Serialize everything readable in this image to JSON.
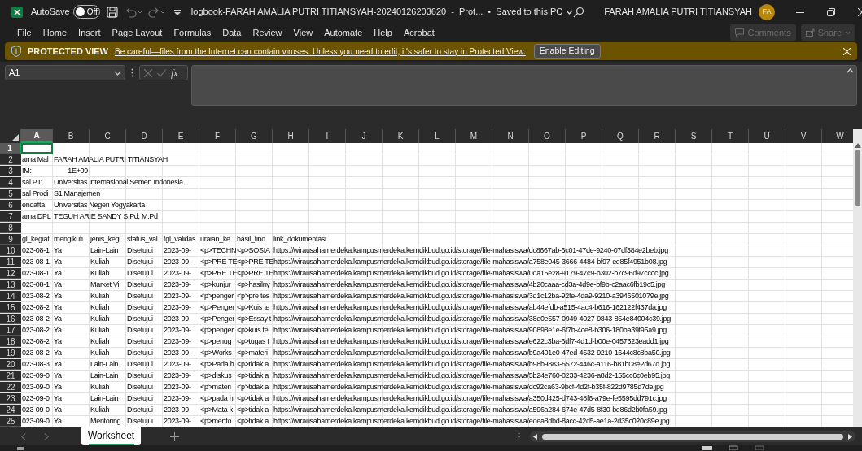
{
  "title_bar": {
    "autosave_label": "AutoSave",
    "autosave": {
      "label": "Off",
      "on": false
    },
    "document_title": "logbook-FARAH AMALIA PUTRI TITIANSYAH-20240126203620  -  Prot...",
    "save_status": "•  Saved to this PC",
    "user_name": "FARAH AMALIA PUTRI TITIANSYAH",
    "avatar_initials": "FA"
  },
  "menu": [
    {
      "label": "File"
    },
    {
      "label": "Home"
    },
    {
      "label": "Insert"
    },
    {
      "label": "Page Layout"
    },
    {
      "label": "Formulas"
    },
    {
      "label": "Data"
    },
    {
      "label": "Review"
    },
    {
      "label": "View"
    },
    {
      "label": "Automate"
    },
    {
      "label": "Help"
    },
    {
      "label": "Acrobat"
    }
  ],
  "ribbon_buttons": [
    {
      "label": "Comments",
      "disabled": true
    },
    {
      "label": "Share",
      "disabled": true
    }
  ],
  "protected_view": {
    "title": "PROTECTED VIEW",
    "message": "Be careful—files from the Internet can contain viruses. Unless you need to edit, it's safer to stay in Protected View.",
    "button": "Enable Editing"
  },
  "formula_bar": {
    "name_box": "A1",
    "function_label": "fx"
  },
  "columns": [
    {
      "label": "A",
      "selected": true
    },
    {
      "label": "B",
      "selected": false
    },
    {
      "label": "C",
      "selected": false
    },
    {
      "label": "D",
      "selected": false
    },
    {
      "label": "E",
      "selected": false
    },
    {
      "label": "F",
      "selected": false
    },
    {
      "label": "G",
      "selected": false
    },
    {
      "label": "H",
      "selected": false
    },
    {
      "label": "I",
      "selected": false
    },
    {
      "label": "J",
      "selected": false
    },
    {
      "label": "K",
      "selected": false
    },
    {
      "label": "L",
      "selected": false
    },
    {
      "label": "M",
      "selected": false
    },
    {
      "label": "N",
      "selected": false
    },
    {
      "label": "O",
      "selected": false
    },
    {
      "label": "P",
      "selected": false
    },
    {
      "label": "Q",
      "selected": false
    },
    {
      "label": "R",
      "selected": false
    },
    {
      "label": "S",
      "selected": false
    },
    {
      "label": "T",
      "selected": false
    },
    {
      "label": "U",
      "selected": false
    },
    {
      "label": "V",
      "selected": false
    },
    {
      "label": "W",
      "selected": false
    }
  ],
  "rows": [
    {
      "number": "1",
      "selected": true
    },
    {
      "number": "2",
      "selected": false,
      "cells": [
        "ama Mal",
        "FARAH AMALIA PUTRI TITIANSYAH"
      ]
    },
    {
      "number": "3",
      "selected": false,
      "cells": [
        "IM:",
        {
          "text": "1E+09",
          "kind": "number"
        }
      ]
    },
    {
      "number": "4",
      "selected": false,
      "cells": [
        "sal PT:",
        "Universitas Internasional Semen Indonesia"
      ]
    },
    {
      "number": "5",
      "selected": false,
      "cells": [
        "sal Prodi",
        "S1 Manajemen"
      ]
    },
    {
      "number": "6",
      "selected": false,
      "cells": [
        "endafta",
        "Universitas Negeri Yogyakarta"
      ]
    },
    {
      "number": "7",
      "selected": false,
      "cells": [
        "ama DPL",
        "TEGUH ARIE SANDY S.Pd, M.Pd"
      ]
    },
    {
      "number": "8",
      "selected": false
    },
    {
      "number": "9",
      "selected": false,
      "cells": [
        "gl_kegiat",
        "mengikuti",
        "jenis_kegi",
        "status_val",
        "tgl_validas",
        "uraian_ke",
        "hasil_tind",
        "link_dokumentasi"
      ]
    },
    {
      "number": "10",
      "selected": false,
      "cells": [
        "023-08-1",
        "Ya",
        "Lain-Lain",
        "Disetujui",
        "2023-09-",
        "<p>TECHN",
        "<p>SOSIA",
        "https://wirausahamerdeka.kampusmerdeka.kemdikbud.go.id/storage/file-mahasiswa/dc8667ab-6c01-47de-9240-07df384e2beb.jpg"
      ]
    },
    {
      "number": "11",
      "selected": false,
      "cells": [
        "023-08-1",
        "Ya",
        "Kuliah",
        "Disetujui",
        "2023-09-",
        "<p>PRE TE",
        "<p>PRE TE",
        "https://wirausahamerdeka.kampusmerdeka.kemdikbud.go.id/storage/file-mahasiswa/a758e045-3666-4484-bf97-ee85f4951b08.jpg"
      ]
    },
    {
      "number": "12",
      "selected": false,
      "cells": [
        "023-08-1",
        "Ya",
        "Kuliah",
        "Disetujui",
        "2023-09-",
        "<p>PRE TE",
        "<p>PRE TE",
        "https://wirausahamerdeka.kampusmerdeka.kemdikbud.go.id/storage/file-mahasiswa/0da15e28-9179-47c9-b302-b7c96d97cccc.jpg"
      ]
    },
    {
      "number": "13",
      "selected": false,
      "cells": [
        "023-08-1",
        "Ya",
        "Market Vi",
        "Disetujui",
        "2023-09-",
        "<p>kunjur",
        "<p>hasilny",
        "https://wirausahamerdeka.kampusmerdeka.kemdikbud.go.id/storage/file-mahasiswa/4b20caaa-cd3a-4d9e-bf9b-c2aac6fb19c5.jpg"
      ]
    },
    {
      "number": "14",
      "selected": false,
      "cells": [
        "023-08-2",
        "Ya",
        "Kuliah",
        "Disetujui",
        "2023-09-",
        "<p>penger",
        "<p>pre tes",
        "https://wirausahamerdeka.kampusmerdeka.kemdikbud.go.id/storage/file-mahasiswa/3d1c12ba-92fe-4da9-9210-a3946501079e.jpg"
      ]
    },
    {
      "number": "15",
      "selected": false,
      "cells": [
        "023-08-2",
        "Ya",
        "Kuliah",
        "Disetujui",
        "2023-09-",
        "<p>Penger",
        "<p>Kuis te",
        "https://wirausahamerdeka.kampusmerdeka.kemdikbud.go.id/storage/file-mahasiswa/ab44efdb-a515-4ac4-b616-162122f437da.jpg"
      ]
    },
    {
      "number": "16",
      "selected": false,
      "cells": [
        "023-08-2",
        "Ya",
        "Kuliah",
        "Disetujui",
        "2023-09-",
        "<p>Penger",
        "<p>Essay t",
        "https://wirausahamerdeka.kampusmerdeka.kemdikbud.go.id/storage/file-mahasiswa/38e0e557-0949-4027-9843-854e84004c39.jpg"
      ]
    },
    {
      "number": "17",
      "selected": false,
      "cells": [
        "023-08-2",
        "Ya",
        "Kuliah",
        "Disetujui",
        "2023-09-",
        "<p>penger",
        "<p>kuis te",
        "https://wirausahamerdeka.kampusmerdeka.kemdikbud.go.id/storage/file-mahasiswa/90898e1e-6f7b-4ce8-b306-180ba39f95a9.jpg"
      ]
    },
    {
      "number": "18",
      "selected": false,
      "cells": [
        "023-08-2",
        "Ya",
        "Kuliah",
        "Disetujui",
        "2023-09-",
        "<p>penug",
        "<p>tugas t",
        "https://wirausahamerdeka.kampusmerdeka.kemdikbud.go.id/storage/file-mahasiswa/e622c3ba-6df7-4d1d-b00e-0457323eadd1.jpg"
      ]
    },
    {
      "number": "19",
      "selected": false,
      "cells": [
        "023-08-2",
        "Ya",
        "Kuliah",
        "Disetujui",
        "2023-09-",
        "<p>Works",
        "<p>materi",
        "https://wirausahamerdeka.kampusmerdeka.kemdikbud.go.id/storage/file-mahasiswa/b9a401e0-47ed-4532-9210-1644c8c8ba50.jpg"
      ]
    },
    {
      "number": "20",
      "selected": false,
      "cells": [
        "023-08-3",
        "Ya",
        "Lain-Lain",
        "Disetujui",
        "2023-09-",
        "<p>Pada h",
        "<p>tidak a",
        "https://wirausahamerdeka.kampusmerdeka.kemdikbud.go.id/storage/file-mahasiswa/b98b9883-5572-446c-a116-b81b08e2d67d.jpg"
      ]
    },
    {
      "number": "21",
      "selected": false,
      "cells": [
        "023-09-0",
        "Ya",
        "Lain-Lain",
        "Disetujui",
        "2023-09-",
        "<p>diskus",
        "<p>tidak a",
        "https://wirausahamerdeka.kampusmerdeka.kemdikbud.go.id/storage/file-mahasiswa/5b24e760-0233-4236-a8d2-155cc6c0eb95.jpg"
      ]
    },
    {
      "number": "22",
      "selected": false,
      "cells": [
        "023-09-0",
        "Ya",
        "Kuliah",
        "Disetujui",
        "2023-09-",
        "<p>materi",
        "<p>tidak a",
        "https://wirausahamerdeka.kampusmerdeka.kemdikbud.go.id/storage/file-mahasiswa/dc92ca63-9bcf-4d2f-b35f-822d9785d7de.jpg"
      ]
    },
    {
      "number": "23",
      "selected": false,
      "cells": [
        "023-09-0",
        "Ya",
        "Lain-Lain",
        "Disetujui",
        "2023-09-",
        "<p>pada h",
        "<p>tidak a",
        "https://wirausahamerdeka.kampusmerdeka.kemdikbud.go.id/storage/file-mahasiswa/a350d425-d743-48f6-a79e-fe5595dd791c.jpg"
      ]
    },
    {
      "number": "24",
      "selected": false,
      "cells": [
        "023-09-0",
        "Ya",
        "Kuliah",
        "Disetujui",
        "2023-09-",
        "<p>Mata k",
        "<p>tidak a",
        "https://wirausahamerdeka.kampusmerdeka.kemdikbud.go.id/storage/file-mahasiswa/a596a284-674e-47d5-8f30-be86d2b0fa59.jpg"
      ]
    },
    {
      "number": "25",
      "selected": false,
      "cells": [
        "023-09-0",
        "Ya",
        "Mentoring",
        "Disetujui",
        "2023-09-",
        "<p>mento",
        "<p>tidak a",
        "https://wirausahamerdeka.kampusmerdeka.kemdikbud.go.id/storage/file-mahasiswa/edea8dbd-8acc-42d5-ae1a-2d35c020c89e.jpg"
      ]
    }
  ],
  "sheet_tabs": [
    {
      "label": "Worksheet",
      "selected": true
    }
  ]
}
